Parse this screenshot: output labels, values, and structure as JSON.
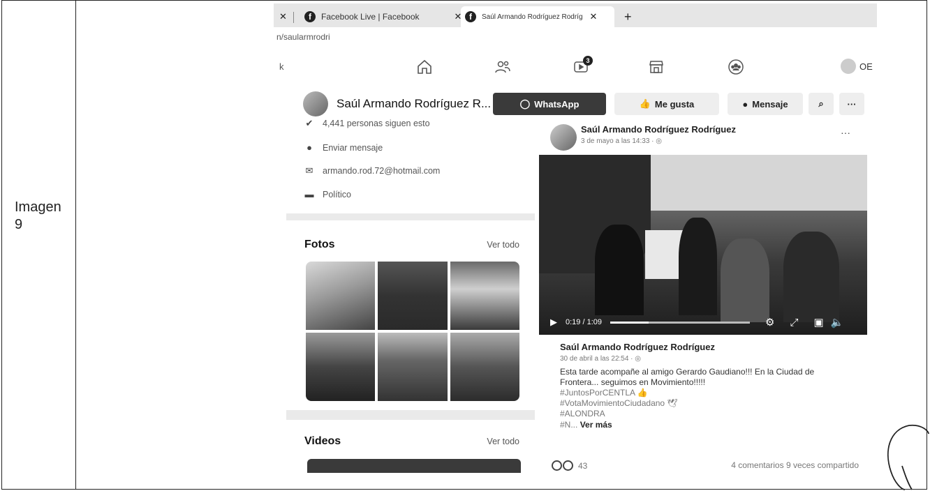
{
  "document": {
    "row_label": "Imagen\n9"
  },
  "browser": {
    "tabs": [
      {
        "label": "Facebook Live | Facebook",
        "active": false
      },
      {
        "label": "Saúl Armando Rodríguez Rodríg",
        "active": true
      }
    ],
    "url_fragment": "n/saularmrodri"
  },
  "fb_nav": {
    "left_text": "k",
    "watch_badge": "3",
    "user_initials": "OE"
  },
  "page_header": {
    "name": "Saúl Armando Rodríguez R...",
    "whatsapp_label": "WhatsApp",
    "like_label": "Me gusta",
    "message_label": "Mensaje"
  },
  "intro": {
    "followers_text": "4,441 personas siguen esto",
    "send_message": "Enviar mensaje",
    "email": "armando.rod.72@hotmail.com",
    "category": "Político"
  },
  "photos": {
    "title": "Fotos",
    "see_all": "Ver todo"
  },
  "videos": {
    "title": "Videos",
    "see_all": "Ver todo"
  },
  "post_top": {
    "author": "Saúl Armando Rodríguez Rodríguez",
    "date": "3 de mayo a las 14:33 · ",
    "video_time": "0:19 / 1:09",
    "video_progress": 0.275
  },
  "post": {
    "author": "Saúl Armando Rodríguez Rodríguez",
    "date": "30 de abril a las 22:54 · ",
    "text": "Esta tarde acompañe al amigo Gerardo Gaudiano!!! En la Ciudad de Frontera... seguimos en Movimiento!!!!!",
    "hashtags": [
      "#JuntosPorCENTLA 👍",
      "#VotaMovimientoCiudadano 🕊",
      "#ALONDRA"
    ],
    "last_line": "#N...",
    "see_more": "Ver más",
    "reactions": "43",
    "comments_shares": "4 comentarios  9 veces compartido"
  },
  "colors": {
    "whatsapp_button": "#3a3a3a",
    "secondary_button": "#eeeeee",
    "page_background": "#ffffff"
  }
}
